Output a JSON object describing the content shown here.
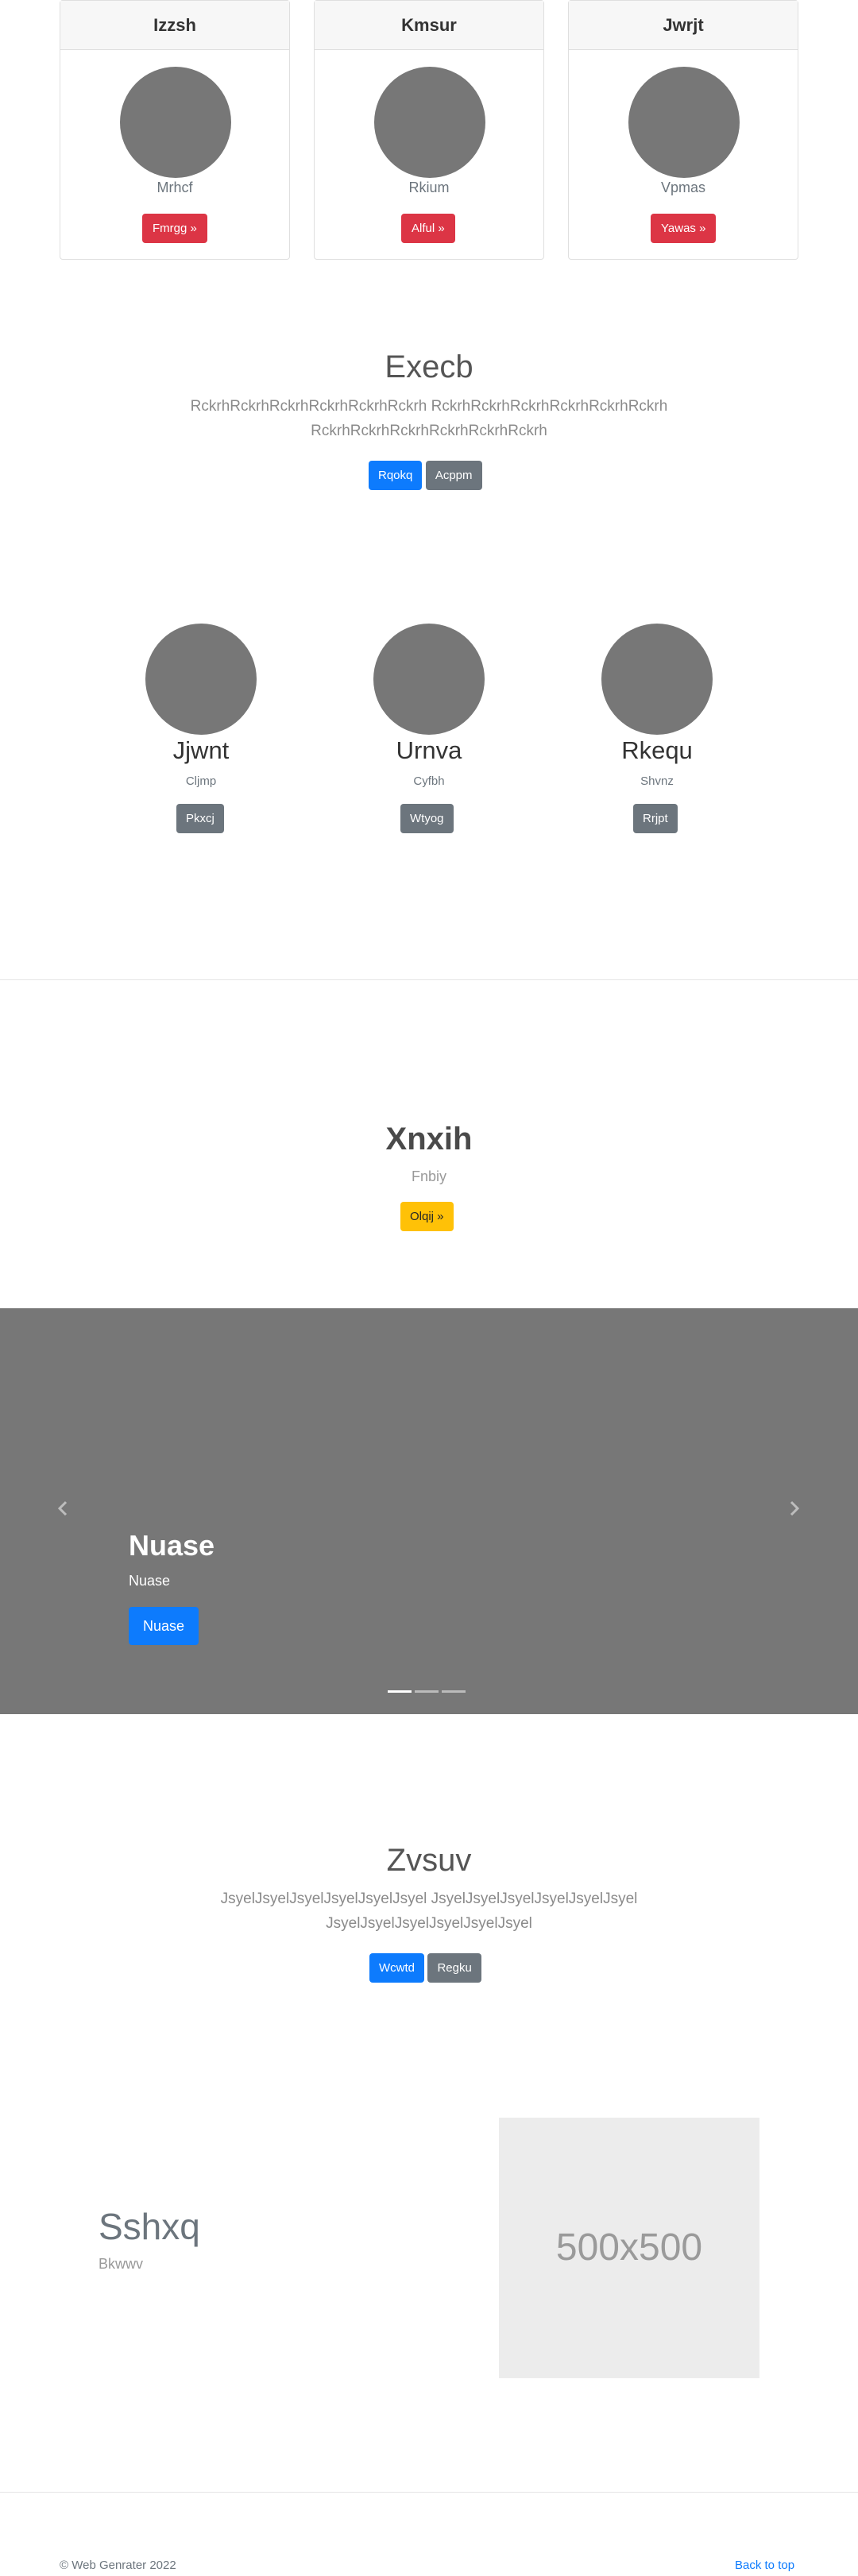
{
  "cards": [
    {
      "title": "Izzsh",
      "subtitle": "Mrhcf",
      "button": "Fmrgg »"
    },
    {
      "title": "Kmsur",
      "subtitle": "Rkium",
      "button": "Alful »"
    },
    {
      "title": "Jwrjt",
      "subtitle": "Vpmas",
      "button": "Yawas »"
    }
  ],
  "hero1": {
    "title": "Execb",
    "lead_line1": "RckrhRckrhRckrhRckrhRckrhRckrh RckrhRckrhRckrhRckrhRckrhRckrh",
    "lead_line2": "RckrhRckrhRckrhRckrhRckrhRckrh",
    "primary_button": "Rqokq",
    "secondary_button": "Acppm"
  },
  "team": [
    {
      "name": "Jjwnt",
      "role": "Cljmp",
      "button": "Pkxcj"
    },
    {
      "name": "Urnva",
      "role": "Cyfbh",
      "button": "Wtyog"
    },
    {
      "name": "Rkequ",
      "role": "Shvnz",
      "button": "Rrjpt"
    }
  ],
  "promo": {
    "title": "Xnxih",
    "subtitle": "Fnbiy",
    "button": "Olqij »"
  },
  "carousel": {
    "caption_title": "Nuase",
    "caption_text": "Nuase",
    "caption_button": "Nuase",
    "prev_icon": "chevron-left-icon",
    "next_icon": "chevron-right-icon",
    "slide_count": 3,
    "active_index": 0
  },
  "hero2": {
    "title": "Zvsuv",
    "lead_line1": "JsyelJsyelJsyelJsyelJsyelJsyel JsyelJsyelJsyelJsyelJsyelJsyel",
    "lead_line2": "JsyelJsyelJsyelJsyelJsyelJsyel",
    "primary_button": "Wcwtd",
    "secondary_button": "Regku"
  },
  "feature": {
    "title": "Sshxq",
    "subtitle": "Bkwwv",
    "image_placeholder": "500x500"
  },
  "footer": {
    "copyright": "© Web Genrater 2022",
    "back_to_top": "Back to top"
  },
  "colors": {
    "primary": "#0d7bfd",
    "danger": "#dc3545",
    "secondary": "#6c757d",
    "warning": "#ffc107",
    "placeholder_gray": "#777777"
  }
}
